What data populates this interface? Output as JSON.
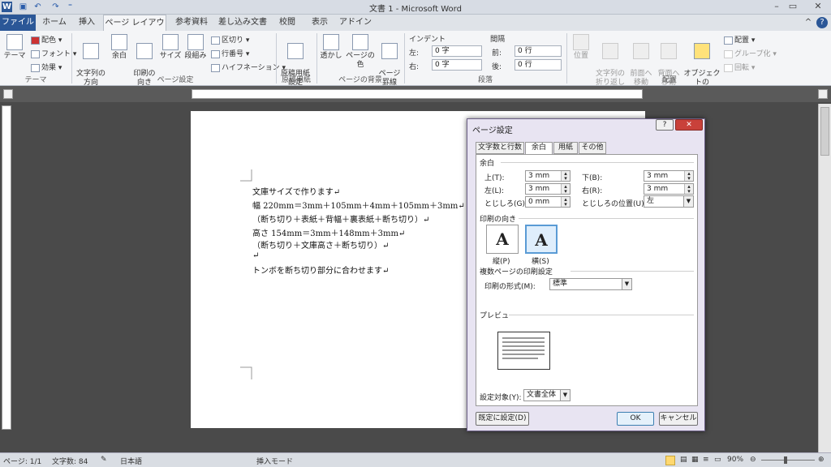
{
  "window": {
    "title": "文書 1 - Microsoft Word"
  },
  "tabs": [
    "ファイル",
    "ホーム",
    "挿入",
    "ページ レイアウト",
    "参考資料",
    "差し込み文書",
    "校閲",
    "表示",
    "アドイン"
  ],
  "ribbon": {
    "theme": {
      "main": "テーマ",
      "colors": "配色",
      "fonts": "フォント",
      "effects": "効果",
      "group": "テーマ"
    },
    "page_setup": {
      "direction": "文字列の\n方向",
      "margins": "余白",
      "orientation": "印刷の\n向き",
      "size": "サイズ",
      "columns": "段組み",
      "breaks": "区切り",
      "line_numbers": "行番号",
      "hyphenation": "ハイフネーション",
      "group": "ページ設定"
    },
    "manuscript": {
      "button": "原稿用紙\n設定",
      "group": "原稿用紙"
    },
    "background": {
      "watermark": "透かし",
      "page_color": "ページの色",
      "page_borders": "ページ\n罫線",
      "group": "ページの背景"
    },
    "paragraph": {
      "indent_label": "インデント",
      "spacing_label": "間隔",
      "left_label": "左:",
      "left_value": "0 字",
      "right_label": "右:",
      "right_value": "0 字",
      "before_label": "前:",
      "before_value": "0 行",
      "after_label": "後:",
      "after_value": "0 行",
      "group": "段落"
    },
    "arrange": {
      "position": "位置",
      "wrap": "文字列の\n折り返し",
      "forward": "前面へ\n移動",
      "backward": "背面へ\n移動",
      "selection": "オブジェクトの\n選択と表示",
      "align": "配置",
      "group_btn": "グループ化",
      "rotate": "回転",
      "group": "配置"
    }
  },
  "document": {
    "lines": [
      "文庫サイズで作ります↵",
      "幅 220mm＝3mm＋105mm＋4mm＋105mm＋3mm↵",
      "（断ち切り＋表紙＋背幅＋裏表紙＋断ち切り）↵",
      "高さ 154mm＝3mm＋148mm＋3mm↵",
      "（断ち切り＋文庫高さ＋断ち切り）↵",
      "↵",
      "トンボを断ち切り部分に合わせます↵"
    ]
  },
  "dialog": {
    "title": "ページ設定",
    "help": "?",
    "close": "✕",
    "tabs": [
      "文字数と行数",
      "余白",
      "用紙",
      "その他"
    ],
    "margins_section": "余白",
    "top_label": "上(T):",
    "top_value": "3 mm",
    "bottom_label": "下(B):",
    "bottom_value": "3 mm",
    "left_label": "左(L):",
    "left_value": "3 mm",
    "right_label": "右(R):",
    "right_value": "3 mm",
    "gutter_label": "とじしろ(G):",
    "gutter_value": "0 mm",
    "gutter_pos_label": "とじしろの位置(U):",
    "gutter_pos_value": "左",
    "orientation_section": "印刷の向き",
    "portrait": "縦(P)",
    "landscape": "横(S)",
    "multipage_section": "複数ページの印刷設定",
    "print_format_label": "印刷の形式(M):",
    "print_format_value": "標準",
    "preview_section": "プレビュー",
    "apply_to_label": "設定対象(Y):",
    "apply_to_value": "文書全体",
    "default_button": "既定に設定(D)",
    "ok_button": "OK",
    "cancel_button": "キャンセル"
  },
  "status": {
    "page": "ページ: 1/1",
    "words": "文字数: 84",
    "language": "日本語",
    "mode": "挿入モード",
    "zoom": "90%"
  }
}
